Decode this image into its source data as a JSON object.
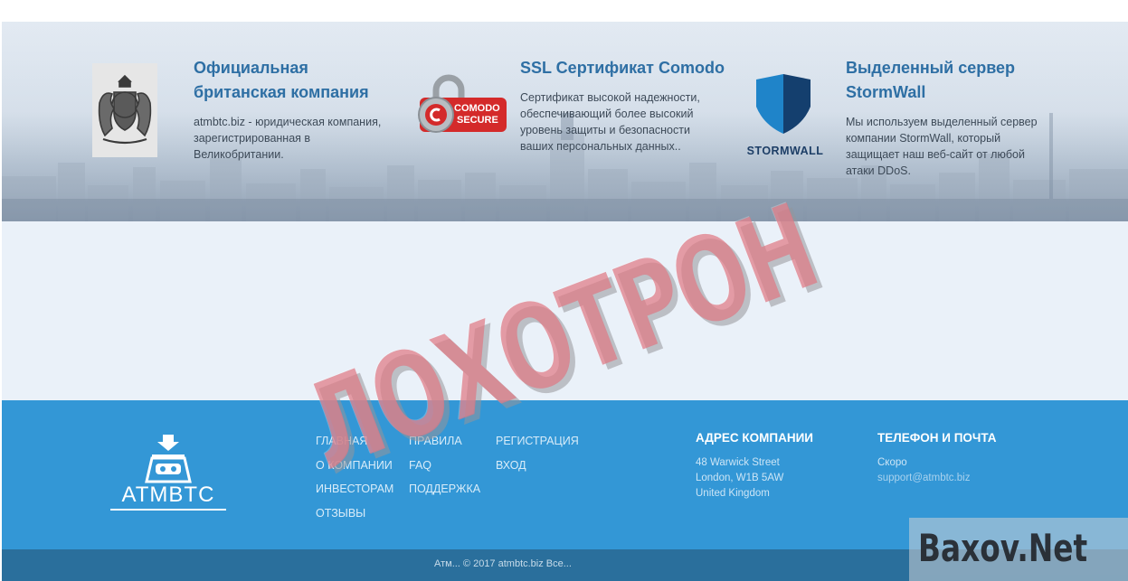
{
  "trust": {
    "cards": [
      {
        "title": "Официальная британская компания",
        "text": "atmbtc.biz - юридическая компания, зарегистрированная в Великобритании.",
        "logo_icon": "uk-royal-coat-of-arms-icon"
      },
      {
        "title": "SSL Сертификат Comodo",
        "text": "Сертификат высокой надежности, обеспечивающий более высокий уровень защиты и безопасности ваших персональных данных..",
        "logo_icon": "comodo-secure-padlock-icon",
        "badge_line1": "COMODO",
        "badge_line2": "SECURE"
      },
      {
        "title": "Выделенный сервер StormWall",
        "text": "Мы используем выделенный сервер компании StormWall, который защищает наш веб-сайт от любой атаки DDoS.",
        "logo_icon": "stormwall-shield-icon",
        "logo_text": "STORMWALL"
      }
    ]
  },
  "footer": {
    "brand": "ATMBTC",
    "brand_icon": "atm-cash-icon",
    "menu": {
      "col1": [
        "ГЛАВНАЯ",
        "О КОМПАНИИ",
        "ИНВЕСТОРАМ",
        "ОТЗЫВЫ"
      ],
      "col2": [
        "ПРАВИЛА",
        "FAQ",
        "ПОДДЕРЖКА"
      ],
      "col3": [
        "РЕГИСТРАЦИЯ",
        "ВХОД"
      ]
    },
    "address": {
      "title": "АДРЕС КОМПАНИИ",
      "lines": [
        "48 Warwick Street",
        "London, W1B 5AW",
        "United Kingdom"
      ]
    },
    "contact": {
      "title": "ТЕЛЕФОН И ПОЧТА",
      "phone": "Скоро",
      "email": "support@atmbtc.biz"
    },
    "copyright": "Атм... © 2017 atmbtc.biz Все..."
  },
  "stamp": "ЛОХОТРОН",
  "watermark": "Baxov.Net",
  "colors": {
    "title_blue": "#2e6fa4",
    "footer_blue": "#3397d6",
    "footer_dark": "#2a6f9c",
    "stamp_red": "#de7884",
    "comodo_red": "#d42a2a",
    "stormwall_blue": "#1f84c9"
  }
}
